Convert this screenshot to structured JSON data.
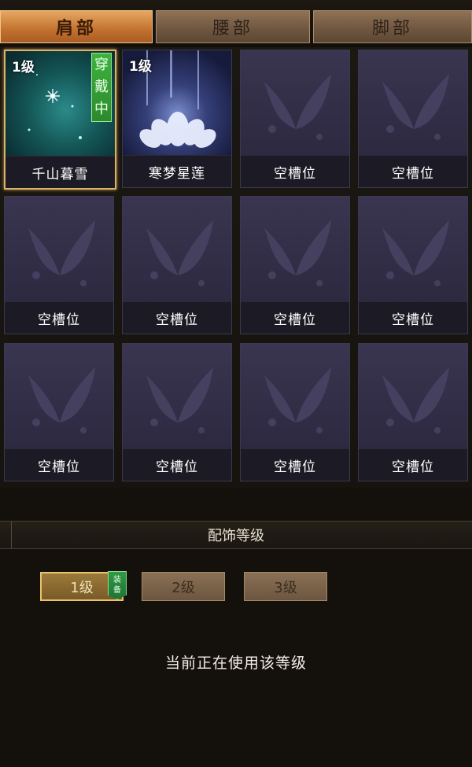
{
  "tabs": [
    {
      "label": "肩部",
      "active": true
    },
    {
      "label": "腰部",
      "active": false
    },
    {
      "label": "脚部",
      "active": false
    }
  ],
  "slots": [
    {
      "name": "千山暮雪",
      "level": "1级",
      "wearing": "穿戴中",
      "art": "snowflake-gem",
      "selected": true
    },
    {
      "name": "寒梦星莲",
      "level": "1级",
      "art": "lotus-gem"
    },
    {
      "name": "空槽位",
      "art": "butterfly-icon"
    },
    {
      "name": "空槽位",
      "art": "butterfly-icon"
    },
    {
      "name": "空槽位",
      "art": "butterfly-icon"
    },
    {
      "name": "空槽位",
      "art": "butterfly-icon"
    },
    {
      "name": "空槽位",
      "art": "butterfly-icon"
    },
    {
      "name": "空槽位",
      "art": "butterfly-icon"
    },
    {
      "name": "空槽位",
      "art": "butterfly-icon"
    },
    {
      "name": "空槽位",
      "art": "butterfly-icon"
    },
    {
      "name": "空槽位",
      "art": "butterfly-icon"
    },
    {
      "name": "空槽位",
      "art": "butterfly-icon"
    }
  ],
  "section": {
    "title": "配饰等级"
  },
  "levels": [
    {
      "label": "1级",
      "active": true
    },
    {
      "label": "2级",
      "active": false
    },
    {
      "label": "3级",
      "active": false
    }
  ],
  "equip_badge": "装备",
  "status_text": "当前正在使用该等级",
  "colors": {
    "tab_active": "#c2712e",
    "slot_bg": "#2e2a42",
    "wearing_green": "#2b8a2b",
    "selected_border": "#d9b46a"
  }
}
